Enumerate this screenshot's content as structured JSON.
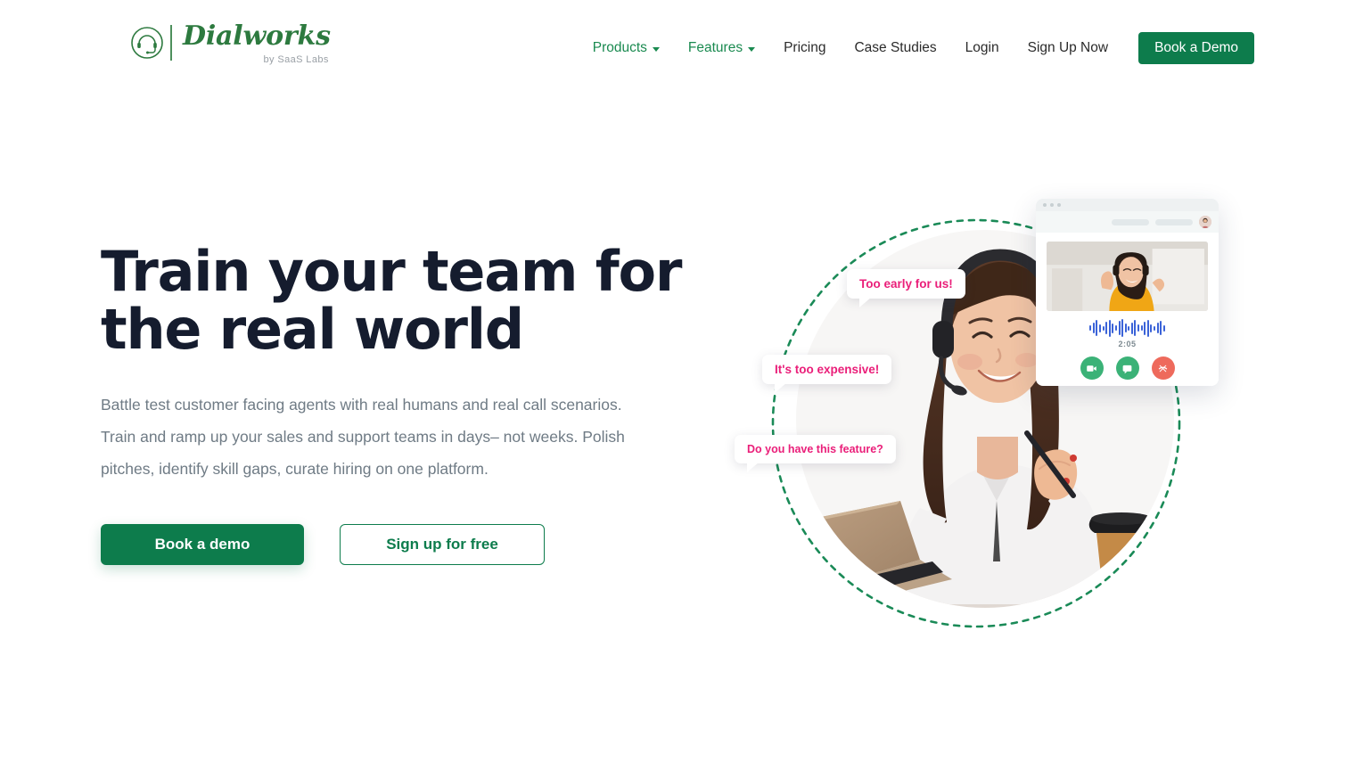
{
  "header": {
    "logo": {
      "name": "Dialworks",
      "sub": "by SaaS Labs",
      "icon": "headset-circle-icon"
    },
    "nav": [
      {
        "label": "Products",
        "green": true,
        "caret": true
      },
      {
        "label": "Features",
        "green": true,
        "caret": true
      },
      {
        "label": "Pricing",
        "green": false,
        "caret": false
      },
      {
        "label": "Case Studies",
        "green": false,
        "caret": false
      },
      {
        "label": "Login",
        "green": false,
        "caret": false
      },
      {
        "label": "Sign Up Now",
        "green": false,
        "caret": false
      }
    ],
    "cta_label": "Book a Demo"
  },
  "hero": {
    "title_line1": "Train your team for",
    "title_line2": "the real world",
    "subtitle": "Battle test customer facing agents with real humans and real call scenarios. Train and ramp up your sales and support teams in days– not weeks. Polish pitches, identify skill gaps, curate hiring on one platform.",
    "primary_cta": "Book a demo",
    "secondary_cta": "Sign up for free"
  },
  "illustration": {
    "bubbles": [
      {
        "text": "Too early for us!"
      },
      {
        "text": "It's too expensive!"
      },
      {
        "text": "Do you have this feature?"
      }
    ],
    "call_card": {
      "timer": "2:05",
      "buttons": [
        {
          "name": "video-icon",
          "color": "#3bb277"
        },
        {
          "name": "chat-icon",
          "color": "#3bb277"
        },
        {
          "name": "end-call-icon",
          "color": "#ee6a5c"
        }
      ]
    }
  },
  "colors": {
    "brand_green": "#0d7c4c",
    "nav_green": "#1a8a50",
    "heading_navy": "#151c2e",
    "body_gray": "#6f7b85",
    "bubble_pink": "#ea1e79",
    "dashed_green": "#1a8a57",
    "waveform_blue": "#3b63d8"
  }
}
